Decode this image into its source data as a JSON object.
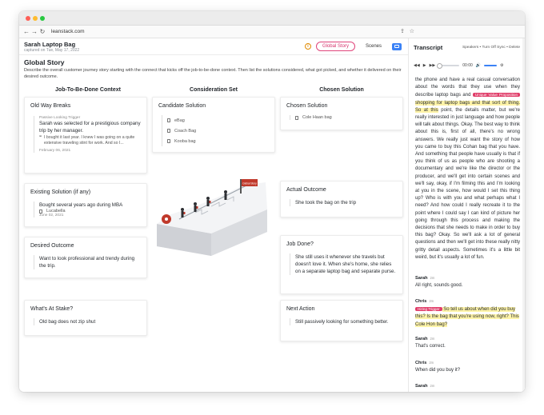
{
  "browser": {
    "url": "leanstack.com"
  },
  "header": {
    "title": "Sarah Laptop Bag",
    "captured": "captured on Tue, May 17, 2022",
    "info_icon": "i",
    "tab_global": "Global Story",
    "tab_scenes": "Scenes"
  },
  "story": {
    "title": "Global Story",
    "description": "Describe the overall customer journey story starting with the connect that kicks off the job-to-be-done context. Then list the solutions considered, what got picked, and whether it delivered on their desired outcome."
  },
  "columns": {
    "jtbd": "Job-To-Be-Done Context",
    "consideration": "Consideration Set",
    "chosen": "Chosen Solution"
  },
  "cards": {
    "old_way": {
      "title": "Old Way Breaks",
      "trigger_label": "Passive Looking Trigger",
      "text": "Sarah was selected for a prestigious company trip by her manager.",
      "quote": "I bought it last year. I knew I was going on a quite extensive traveling stint for work. And so I...",
      "date": "February 06, 2021"
    },
    "existing": {
      "title": "Existing Solution (if any)",
      "text": "Bought several years ago during MBA",
      "source": "Lucabella",
      "date": "June 02, 2021"
    },
    "desired": {
      "title": "Desired Outcome",
      "text": "Want to look professional and trendy during the trip."
    },
    "stake": {
      "title": "What's At Stake?",
      "text": "Old bag does not zip shut"
    },
    "candidate": {
      "title": "Candidate Solution",
      "items": [
        "eBag",
        "Coach Bag",
        "Kooba bag"
      ]
    },
    "chosen": {
      "title": "Chosen Solution",
      "item": "Cole Haan bag"
    },
    "actual": {
      "title": "Actual Outcome",
      "text": "She took the bag on the trip"
    },
    "job_done": {
      "title": "Job Done?",
      "text": "She still uses it whenever she travels but doesn't love it. When she's home, she relies on a separate laptop bag and separate purse."
    },
    "next": {
      "title": "Next Action",
      "text": "Still passively looking for something better."
    }
  },
  "illustration": {
    "flag_text": "Global Story"
  },
  "transcript": {
    "title": "Transcript",
    "links": "Speakers • Turn Off Sync • Delete",
    "time": "00:00",
    "body_1": "the phone and have a real casual conversation about the words that they use when they describe laptop bags and ",
    "tag_1": "Unique Value Proposition",
    "hl_1": " shopping for laptop bags and that sort of thing. So at this",
    "body_2": " point, the details matter, but we're really interested in just language and how people will talk about things. Okay. The best way to think about this is, first of all, there's no wrong answers. We really just want the story of how you came to buy this Cohan bag that you have. And something that people have usually is that if you think of us as people who are shooting a documentary and we're like the director or the producer, and we'll get into certain scenes and we'll say, okay, if I'm filming this and I'm looking at you in the scene, how would I set this thing up? Who is with you and what perhaps what I need? And how could I really recreate it to the point where I could say I can kind of picture her going through this process and making the decisions that she needs to make in order to buy this bag? Okay. So we'll ask a lot of general questions and then we'll get into these really nitty gritty detail aspects. Sometimes it's a little bit weird, but it's usually a lot of fun.",
    "msg1_speaker": "Sarah",
    "msg1_time": "2m",
    "msg1_text": "All right, sounds good.",
    "msg2_speaker": "Chris",
    "msg2_time": "2m",
    "tag_2": "Hiring Trigger",
    "msg2_hl": " So tell us about when did you buy this? Is the bag that you're using now, right? This Cole Hon bag?",
    "msg3_speaker": "Sarah",
    "msg3_time": "2m",
    "msg3_text": "That's correct.",
    "msg4_speaker": "Chris",
    "msg4_time": "2m",
    "msg4_text": "When did you buy it?",
    "msg5_speaker": "Sarah",
    "msg5_time": "2m"
  }
}
